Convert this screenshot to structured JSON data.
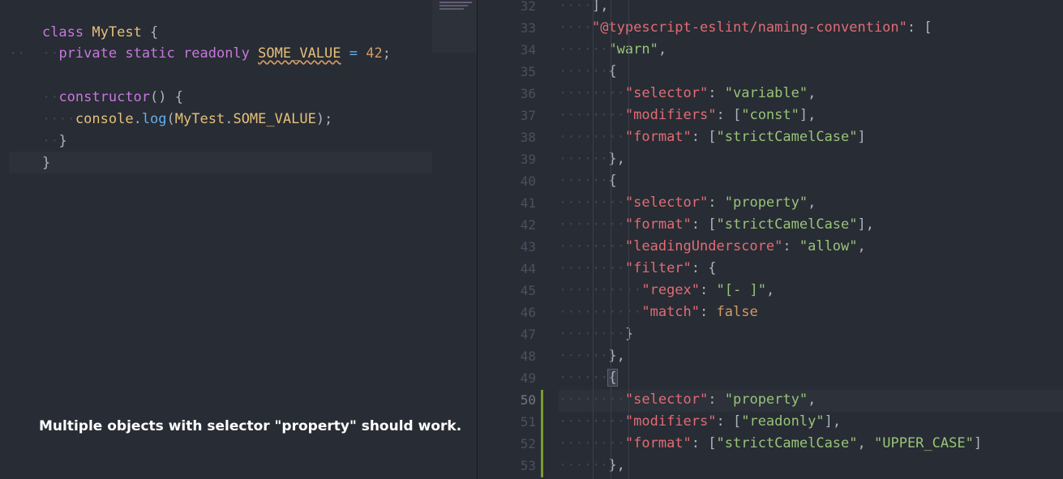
{
  "left_editor": {
    "lines": [
      [
        "class",
        " ",
        "MyTest",
        " {"
      ],
      [
        "private",
        " ",
        "static",
        " ",
        "readonly",
        " ",
        "SOME_VALUE",
        " = ",
        "42",
        ";"
      ],
      [],
      [
        "constructor",
        "() {"
      ],
      [
        "console",
        ".",
        "log",
        "(",
        "MyTest",
        ".",
        "SOME_VALUE",
        ");"
      ],
      [
        "}"
      ],
      [
        "}"
      ]
    ]
  },
  "caption": "Multiple objects with selector \"property\" should work.",
  "right_editor": {
    "line_numbers": [
      "32",
      "33",
      "34",
      "35",
      "36",
      "37",
      "38",
      "39",
      "40",
      "41",
      "42",
      "43",
      "44",
      "45",
      "46",
      "47",
      "48",
      "49",
      "50",
      "51",
      "52",
      "53"
    ],
    "lines": [
      "],",
      "\"@typescript-eslint/naming-convention\": [",
      "\"warn\",",
      "{",
      "\"selector\": \"variable\",",
      "\"modifiers\": [\"const\"],",
      "\"format\": [\"strictCamelCase\"]",
      "},",
      "{",
      "\"selector\": \"property\",",
      "\"format\": [\"strictCamelCase\"],",
      "\"leadingUnderscore\": \"allow\",",
      "\"filter\": {",
      "\"regex\": \"[- ]\",",
      "\"match\": false",
      "}",
      "},",
      "{",
      "\"selector\": \"property\",",
      "\"modifiers\": [\"readonly\"],",
      "\"format\": [\"strictCamelCase\", \"UPPER_CASE\"]",
      "},"
    ]
  },
  "colors": {
    "background": "#282c34",
    "keyword": "#c678dd",
    "class": "#e5c07b",
    "property": "#e06c75",
    "string": "#98c379",
    "number": "#d19a66",
    "function": "#61afef"
  }
}
